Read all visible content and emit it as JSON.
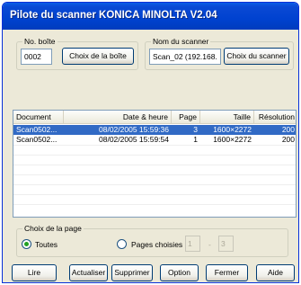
{
  "window": {
    "title": "Pilote du scanner KONICA MINOLTA V2.04"
  },
  "box_group": {
    "legend": "No. boîte",
    "value": "0002",
    "button_label": "Choix de la boîte"
  },
  "scanner_group": {
    "legend": "Nom du scanner",
    "value": "Scan_02 (192.168.",
    "button_label": "Choix du scanner"
  },
  "table": {
    "columns": [
      "Document",
      "Date & heure",
      "Page",
      "Taille",
      "Résolution"
    ],
    "rows": [
      [
        "Scan0502...",
        "08/02/2005 15:59:36",
        "3",
        "1600×2272",
        "200"
      ],
      [
        "Scan0502...",
        "08/02/2005 15:59:54",
        "1",
        "1600×2272",
        "200"
      ]
    ],
    "selected_row": 0
  },
  "page_choice": {
    "legend": "Choix de la page",
    "option_all": "Toutes",
    "option_selected": "Pages choisies",
    "from": "1",
    "separator": "-",
    "to": "3"
  },
  "buttons": {
    "read": "Lire",
    "refresh": "Actualiser",
    "delete": "Supprimer",
    "option": "Option",
    "close": "Fermer",
    "help": "Aide"
  }
}
